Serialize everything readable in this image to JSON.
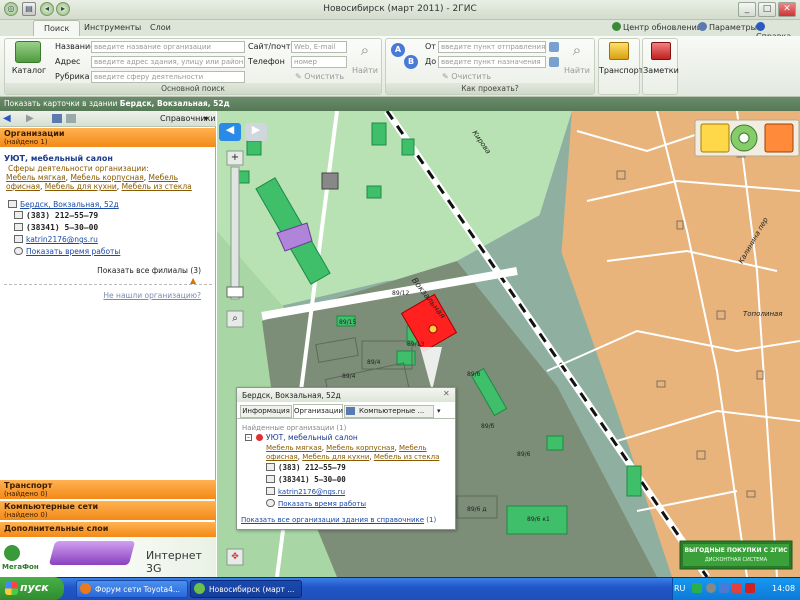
{
  "window": {
    "title": "Новосибирск (март 2011) - 2ГИС",
    "minimize": "_",
    "maximize": "□",
    "close": "✕"
  },
  "tabs": [
    "Поиск",
    "Инструменты",
    "Слои"
  ],
  "top_links": {
    "updates": "Центр обновлений",
    "settings": "Параметры",
    "help": "Справка"
  },
  "search": {
    "catalog": "Каталог",
    "name_label": "Название",
    "name_placeholder": "введите название организации",
    "address_label": "Адрес",
    "address_placeholder": "введите адрес здания, улицу или район",
    "rubric_label": "Рубрика",
    "rubric_placeholder": "введите сферу деятельности",
    "site_label": "Сайт/почта",
    "site_placeholder": "Web, E-mail",
    "phone_label": "Телефон",
    "phone_placeholder": "номер",
    "clear": "Очистить",
    "find": "Найти",
    "group_label": "Основной поиск"
  },
  "route": {
    "from_label": "От",
    "from_placeholder": "введите пункт отправления",
    "to_label": "До",
    "to_placeholder": "введите пункт назначения",
    "clear": "Очистить",
    "find": "Найти",
    "group_label": "Как проехать?"
  },
  "ribbon_buttons": {
    "transport": "Транспорт",
    "notes": "Заметки"
  },
  "status": {
    "prefix": "Показать карточки в здании",
    "address": "Бердск, Вокзальная, 52д"
  },
  "left": {
    "directories": "Справочники",
    "orgs_header": "Организации",
    "orgs_found": "(найдено 1)",
    "org_name": "УЮТ, мебельный салон",
    "spheres_label": "Сферы деятельности организации:",
    "spheres": [
      "Мебель мягкая",
      "Мебель корпусная",
      "Мебель офисная",
      "Мебель для кухни",
      "Мебель из стекла"
    ],
    "address": "Бердск, Вокзальная, 52д",
    "phone1": "(383) 212–55–79",
    "phone2": "(38341) 5–30–00",
    "email": "katrin2176@ngs.ru",
    "hours": "Показать время работы",
    "all_branches": "Показать все филиалы (3)",
    "not_found": "Не нашли организацию?",
    "transport_header": "Транспорт",
    "transport_found": "(найдено 0)",
    "networks_header": "Компьютерные сети",
    "networks_found": "(найдено 0)",
    "layers_header": "Дополнительные слои"
  },
  "promo": {
    "brand": "МегаФон",
    "text": "Интернет 3G"
  },
  "popup": {
    "title": "Бердск, Вокзальная, 52д",
    "tabs": [
      "Информация",
      "Организации",
      "Компьютерные ..."
    ],
    "found": "Найденные организации (1)",
    "org_name": "УЮТ, мебельный салон",
    "spheres": [
      "Мебель мягкая",
      "Мебель корпусная",
      "Мебель офисная",
      "Мебель для кухни",
      "Мебель из стекла"
    ],
    "phone1": "(383) 212–55–79",
    "phone2": "(38341) 5–30–00",
    "email": "katrin2176@ngs.ru",
    "hours": "Показать время работы",
    "all_orgs": "Показать все организации здания в справочнике",
    "all_orgs_count": "(1)"
  },
  "map": {
    "streets": [
      "Вокзальная",
      "Кирова",
      "Калинина пер",
      "Тополиная"
    ],
    "house_numbers": [
      "89/12",
      "89/15",
      "89/13",
      "89/4",
      "89/4",
      "89/б",
      "89/б",
      "89/6",
      "89/6 д",
      "89/6 к1"
    ],
    "banner_title": "ВЫГОДНЫЕ ПОКУПКИ С 2ГИС",
    "banner_sub": "ДИСКОНТНАЯ СИСТЕМА"
  },
  "taskbar": {
    "start": "пуск",
    "task1": "Форум сети Toyota4...",
    "task2": "Новосибирск (март ...",
    "lang": "RU",
    "clock": "14:08"
  },
  "colors": {
    "accent_orange": "#f28a17",
    "map_land": "#8fb0a0",
    "building_green": "#3fbf6a",
    "selected_building": "#ff2020",
    "private_zone": "#e8b47c"
  }
}
